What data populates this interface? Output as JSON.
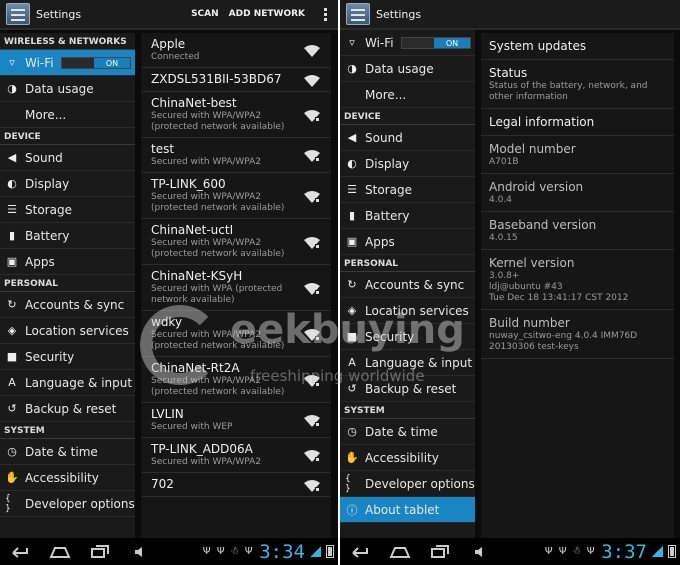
{
  "left": {
    "actionbar": {
      "title": "Settings",
      "scan_label": "SCAN",
      "add_network_label": "ADD NETWORK"
    },
    "menu": [
      {
        "type": "header",
        "label": "WIRELESS & NETWORKS"
      },
      {
        "type": "item",
        "label": "Wi-Fi",
        "icon": "wifi-icon",
        "active": true,
        "toggle": "ON"
      },
      {
        "type": "item",
        "label": "Data usage",
        "icon": "data-usage-icon"
      },
      {
        "type": "item",
        "label": "More...",
        "icon": ""
      },
      {
        "type": "header",
        "label": "DEVICE"
      },
      {
        "type": "item",
        "label": "Sound",
        "icon": "sound-icon"
      },
      {
        "type": "item",
        "label": "Display",
        "icon": "display-icon"
      },
      {
        "type": "item",
        "label": "Storage",
        "icon": "storage-icon"
      },
      {
        "type": "item",
        "label": "Battery",
        "icon": "battery-icon"
      },
      {
        "type": "item",
        "label": "Apps",
        "icon": "apps-icon"
      },
      {
        "type": "header",
        "label": "PERSONAL"
      },
      {
        "type": "item",
        "label": "Accounts & sync",
        "icon": "sync-icon"
      },
      {
        "type": "item",
        "label": "Location services",
        "icon": "location-icon"
      },
      {
        "type": "item",
        "label": "Security",
        "icon": "lock-icon"
      },
      {
        "type": "item",
        "label": "Language & input",
        "icon": "language-icon"
      },
      {
        "type": "item",
        "label": "Backup & reset",
        "icon": "backup-icon"
      },
      {
        "type": "header",
        "label": "SYSTEM"
      },
      {
        "type": "item",
        "label": "Date & time",
        "icon": "clock-icon"
      },
      {
        "type": "item",
        "label": "Accessibility",
        "icon": "hand-icon"
      },
      {
        "type": "item",
        "label": "Developer options",
        "icon": "braces-icon"
      }
    ],
    "networks": [
      {
        "name": "Apple",
        "status": "Connected",
        "secured": false
      },
      {
        "name": "ZXDSL531BII-53BD67",
        "status": "",
        "secured": false
      },
      {
        "name": "ChinaNet-best",
        "status": "Secured with WPA/WPA2\n(protected network available)",
        "secured": true
      },
      {
        "name": "test",
        "status": "Secured with WPA/WPA2",
        "secured": true
      },
      {
        "name": "TP-LINK_600",
        "status": "Secured with WPA/WPA2\n(protected network available)",
        "secured": true
      },
      {
        "name": "ChinaNet-uctI",
        "status": "Secured with WPA/WPA2\n(protected network available)",
        "secured": true
      },
      {
        "name": "ChinaNet-KSyH",
        "status": "Secured with WPA (protected\nnetwork available)",
        "secured": true
      },
      {
        "name": "wdky",
        "status": "Secured with WPA/WPA2\n(protected network available)",
        "secured": true
      },
      {
        "name": "ChinaNet-Rt2A",
        "status": "Secured with WPA/WPA2\n(protected network available)",
        "secured": true
      },
      {
        "name": "LVLIN",
        "status": "Secured with WEP",
        "secured": true
      },
      {
        "name": "TP-LINK_ADD06A",
        "status": "Secured with WPA/WPA2",
        "secured": true
      },
      {
        "name": "702",
        "status": "",
        "secured": true
      }
    ],
    "clock": "3:34"
  },
  "right": {
    "actionbar": {
      "title": "Settings"
    },
    "menu": [
      {
        "type": "item",
        "label": "Wi-Fi",
        "icon": "wifi-icon",
        "toggle": "ON"
      },
      {
        "type": "item",
        "label": "Data usage",
        "icon": "data-usage-icon"
      },
      {
        "type": "item",
        "label": "More...",
        "icon": ""
      },
      {
        "type": "header",
        "label": "DEVICE"
      },
      {
        "type": "item",
        "label": "Sound",
        "icon": "sound-icon"
      },
      {
        "type": "item",
        "label": "Display",
        "icon": "display-icon"
      },
      {
        "type": "item",
        "label": "Storage",
        "icon": "storage-icon"
      },
      {
        "type": "item",
        "label": "Battery",
        "icon": "battery-icon"
      },
      {
        "type": "item",
        "label": "Apps",
        "icon": "apps-icon"
      },
      {
        "type": "header",
        "label": "PERSONAL"
      },
      {
        "type": "item",
        "label": "Accounts & sync",
        "icon": "sync-icon"
      },
      {
        "type": "item",
        "label": "Location services",
        "icon": "location-icon"
      },
      {
        "type": "item",
        "label": "Security",
        "icon": "lock-icon"
      },
      {
        "type": "item",
        "label": "Language & input",
        "icon": "language-icon"
      },
      {
        "type": "item",
        "label": "Backup & reset",
        "icon": "backup-icon"
      },
      {
        "type": "header",
        "label": "SYSTEM"
      },
      {
        "type": "item",
        "label": "Date & time",
        "icon": "clock-icon"
      },
      {
        "type": "item",
        "label": "Accessibility",
        "icon": "hand-icon"
      },
      {
        "type": "item",
        "label": "Developer options",
        "icon": "braces-icon"
      },
      {
        "type": "item",
        "label": "About tablet",
        "icon": "info-icon",
        "active": true
      }
    ],
    "about": [
      {
        "title": "System updates",
        "sub": "",
        "muted": false
      },
      {
        "title": "Status",
        "sub": "Status of the battery, network, and\nother information",
        "muted": false
      },
      {
        "title": "Legal information",
        "sub": "",
        "muted": false
      },
      {
        "title": "Model number",
        "sub": "A701B",
        "muted": true
      },
      {
        "title": "Android version",
        "sub": "4.0.4",
        "muted": true
      },
      {
        "title": "Baseband version",
        "sub": "4.0.15",
        "muted": true
      },
      {
        "title": "Kernel version",
        "sub": "3.0.8+\nldj@ubuntu #43\nTue Dec 18 13:41:17 CST 2012",
        "muted": true
      },
      {
        "title": "Build number",
        "sub": "nuway_csitwo-eng 4.0.4 IMM76D\n20130306 test-keys",
        "muted": true
      }
    ],
    "clock": "3:37"
  },
  "watermark": {
    "brand": "eekbuying",
    "tagline": "freeshipping worldwide"
  },
  "colors": {
    "accent": "#1985c2",
    "clock": "#34b6e6",
    "background": "#0b0b0b"
  }
}
